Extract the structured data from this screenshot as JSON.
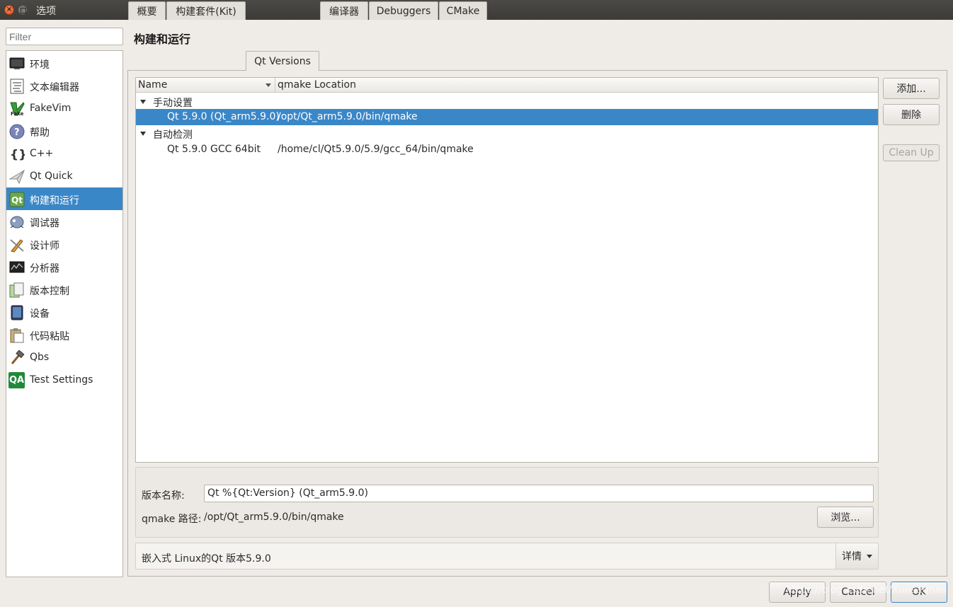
{
  "window": {
    "title": "选项"
  },
  "filter": {
    "placeholder": "Filter"
  },
  "categories": [
    {
      "label": "环境",
      "icon": "monitor-icon"
    },
    {
      "label": "文本编辑器",
      "icon": "text-editor-icon"
    },
    {
      "label": "FakeVim",
      "icon": "fakevim-icon"
    },
    {
      "label": "帮助",
      "icon": "help-icon"
    },
    {
      "label": "C++",
      "icon": "cpp-braces-icon"
    },
    {
      "label": "Qt Quick",
      "icon": "paper-plane-icon"
    },
    {
      "label": "构建和运行",
      "icon": "qt-build-icon",
      "selected": true
    },
    {
      "label": "调试器",
      "icon": "debugger-bug-icon"
    },
    {
      "label": "设计师",
      "icon": "designer-brush-icon"
    },
    {
      "label": "分析器",
      "icon": "analyzer-icon"
    },
    {
      "label": "版本控制",
      "icon": "version-control-icon"
    },
    {
      "label": "设备",
      "icon": "device-tablet-icon"
    },
    {
      "label": "代码粘贴",
      "icon": "clipboard-icon"
    },
    {
      "label": "Qbs",
      "icon": "hammer-icon"
    },
    {
      "label": "Test Settings",
      "icon": "qa-icon",
      "icon_text": "QA"
    }
  ],
  "page": {
    "title": "构建和运行"
  },
  "tabs": [
    {
      "label": "概要"
    },
    {
      "label": "构建套件(Kit)"
    },
    {
      "label": "Qt Versions",
      "active": true
    },
    {
      "label": "编译器"
    },
    {
      "label": "Debuggers"
    },
    {
      "label": "CMake"
    }
  ],
  "tree": {
    "headers": {
      "name": "Name",
      "location": "qmake Location"
    },
    "groups": [
      {
        "label": "手动设置",
        "items": [
          {
            "name": "Qt 5.9.0 (Qt_arm5.9.0)",
            "location": "/opt/Qt_arm5.9.0/bin/qmake",
            "selected": true
          }
        ]
      },
      {
        "label": "自动检测",
        "items": [
          {
            "name": "Qt 5.9.0 GCC 64bit",
            "location": "/home/cl/Qt5.9.0/5.9/gcc_64/bin/qmake",
            "selected": false
          }
        ]
      }
    ]
  },
  "side_buttons": {
    "add": "添加...",
    "remove": "删除",
    "cleanup": "Clean Up"
  },
  "details": {
    "version_name_label": "版本名称:",
    "version_name_value": "Qt %{Qt:Version} (Qt_arm5.9.0)",
    "qmake_path_label": "qmake 路径:",
    "qmake_path_value": "/opt/Qt_arm5.9.0/bin/qmake",
    "browse": "浏览..."
  },
  "info": {
    "text": "嵌入式 Linux的Qt 版本5.9.0",
    "details_button": "详情"
  },
  "dialog_buttons": {
    "apply": "Apply",
    "cancel": "Cancel",
    "ok": "OK"
  },
  "watermark": "https://blog.csdn.net/Xuosagnao",
  "colors": {
    "selection": "#3a87c8",
    "window_bg": "#efebe7",
    "titlebar": "#3c3b37"
  }
}
